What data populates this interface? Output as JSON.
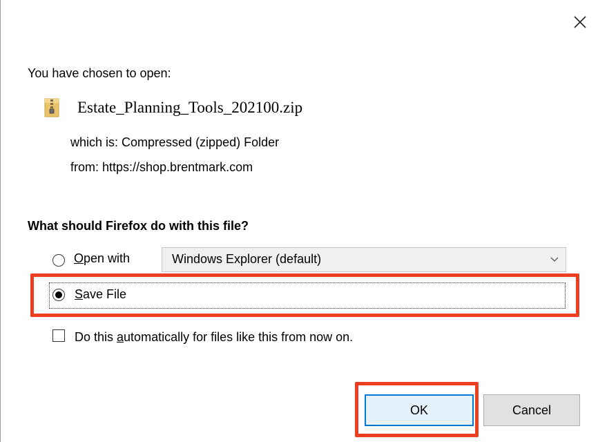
{
  "dialog": {
    "intro": "You have chosen to open:",
    "file_name": "Estate_Planning_Tools_202100.zip",
    "file_type": "which is: Compressed (zipped) Folder",
    "file_from": "from:  https://shop.brentmark.com",
    "question": "What should Firefox do with this file?",
    "open_with": {
      "accel": "O",
      "rest": "pen with",
      "selected": false
    },
    "open_with_app": "Windows Explorer (default)",
    "save_file": {
      "accel": "S",
      "rest": "ave File",
      "selected": true
    },
    "auto": {
      "pre": "Do this ",
      "accel": "a",
      "rest": "utomatically for files like this from now on.",
      "checked": false
    },
    "ok_label": "OK",
    "cancel_label": "Cancel"
  },
  "colors": {
    "highlight": "#ee3e22",
    "ok_border": "#0078d7",
    "ok_bg": "#e5f1fb",
    "button_bg": "#e1e1e1"
  },
  "icons": {
    "close": "close-icon",
    "file": "zip-folder-icon",
    "dropdown": "chevron-down-icon"
  }
}
